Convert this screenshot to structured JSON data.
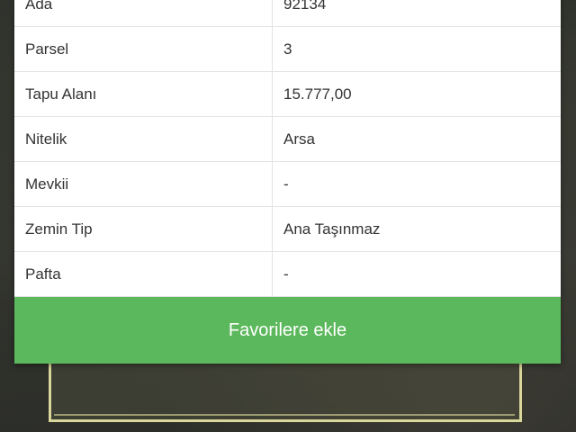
{
  "parcel_info": {
    "rows": [
      {
        "label": "Ada",
        "value": "92134"
      },
      {
        "label": "Parsel",
        "value": "3"
      },
      {
        "label": "Tapu Alanı",
        "value": "15.777,00"
      },
      {
        "label": "Nitelik",
        "value": "Arsa"
      },
      {
        "label": "Mevkii",
        "value": "-"
      },
      {
        "label": "Zemin Tip",
        "value": "Ana Taşınmaz"
      },
      {
        "label": "Pafta",
        "value": "-"
      }
    ]
  },
  "actions": {
    "add_to_favorites_label": "Favorilere ekle",
    "button_color": "#5cb85c"
  }
}
